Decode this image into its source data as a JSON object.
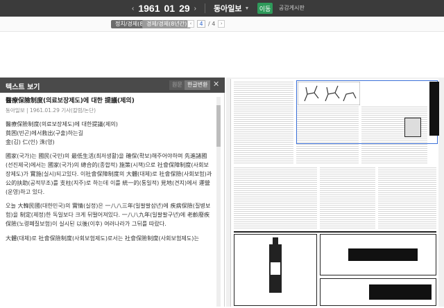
{
  "topbar": {
    "prev_arrow": "‹",
    "year": "1961",
    "month": "01",
    "day": "29",
    "next_arrow": "›",
    "newspaper": "동아일보",
    "move_label": "이동",
    "board_label": "공감게시판"
  },
  "subbar": {
    "tab1": "정치/경제(8년간)",
    "tab2": "경제/경제(8년간)",
    "page_current": "4",
    "page_total": "/ 4"
  },
  "left": {
    "header": "텍스트 보기",
    "btn_original": "원문",
    "btn_hangul": "한글변환",
    "close": "✕",
    "title": "醫療保險制度(의료보장제도)에 대한 提議(제의)",
    "meta": "동아일보 | 1961.01.29 기사(칼럼/논단)",
    "paragraphs": [
      "醫療保險制度(의료보장제도)에 대한提議(제의)\n貧困(빈곤)에서救出(구출)하는길\n金(김) 仁(인) 洙(영)",
      "國家(국가)는 國民(국민)의 最低生活(최저생활)을 確保(확보)해주어야하며 先進諸國(선진제국)에서는 國家(국가)의 總合的(종합적) 施策(시책)으로 社會保障制度(사회보장제도)가 實施(실시)되고있다. 이社會保障制度의 大體(대체)로 社會保險(사회보험)과 公的扶助(공적부조)를 支柱(지주)로 하는데 이를 統一的(통일적) 見地(견지)에서 運營(운영)하고 있다.",
      "오늘 大韓民國(대한민국)의 實情(실정)은 一八八三年(일팔팔삼년)에 疾病保險(질병보험)을 制定(제정)한 독일보다 크게 뒤떨어져있다. 一八八九年(일팔팔구년)에 老齡廢疾保險(노령폐질보험)이 실시된 以後(이후) 여러나라가 그뒤를 따랐다.",
      "大體(대체)로 社會保險制度(사회보험제도)로서는 社會保險制度(사회보험제도)는"
    ]
  },
  "right": {
    "page_alt": "newspaper-page-scan"
  }
}
